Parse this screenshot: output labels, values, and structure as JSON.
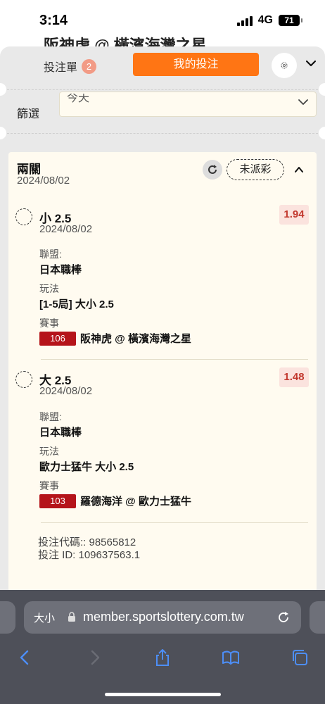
{
  "status_bar": {
    "time": "3:14",
    "network": "4G",
    "battery": "71"
  },
  "background_peek": "阪神虎 @ 橫濱海灣之星",
  "header": {
    "betslip_label": "投注單",
    "betslip_count": "2",
    "mybets_label": "我的投注"
  },
  "filter": {
    "label": "篩選",
    "value": "今天"
  },
  "bet": {
    "title": "兩關",
    "date": "2024/08/02",
    "status": "未派彩",
    "selections": [
      {
        "name": "小 2.5",
        "date": "2024/08/02",
        "odds": "1.94",
        "league_label": "聯盟:",
        "league": "日本職棒",
        "market_label": "玩法",
        "market": "[1-5局] 大小 2.5",
        "event_label": "賽事",
        "event_code": "106",
        "event": "阪神虎 @ 橫濱海灣之星"
      },
      {
        "name": "大 2.5",
        "date": "2024/08/02",
        "odds": "1.48",
        "league_label": "聯盟:",
        "league": "日本職棒",
        "market_label": "玩法",
        "market": "歐力士猛牛 大小 2.5",
        "event_label": "賽事",
        "event_code": "103",
        "event": "羅德海洋 @ 歐力士猛牛"
      }
    ],
    "bet_code": "投注代碼:: 98565812",
    "bet_id": "投注 ID: 109637563.1"
  },
  "browser": {
    "aa_label": "大小",
    "url": "member.sportslottery.com.tw"
  },
  "colors": {
    "accent": "#ff7514",
    "odds_text": "#c2382e",
    "match_code_bg": "#b5141a",
    "card_bg": "#fffbf0"
  }
}
